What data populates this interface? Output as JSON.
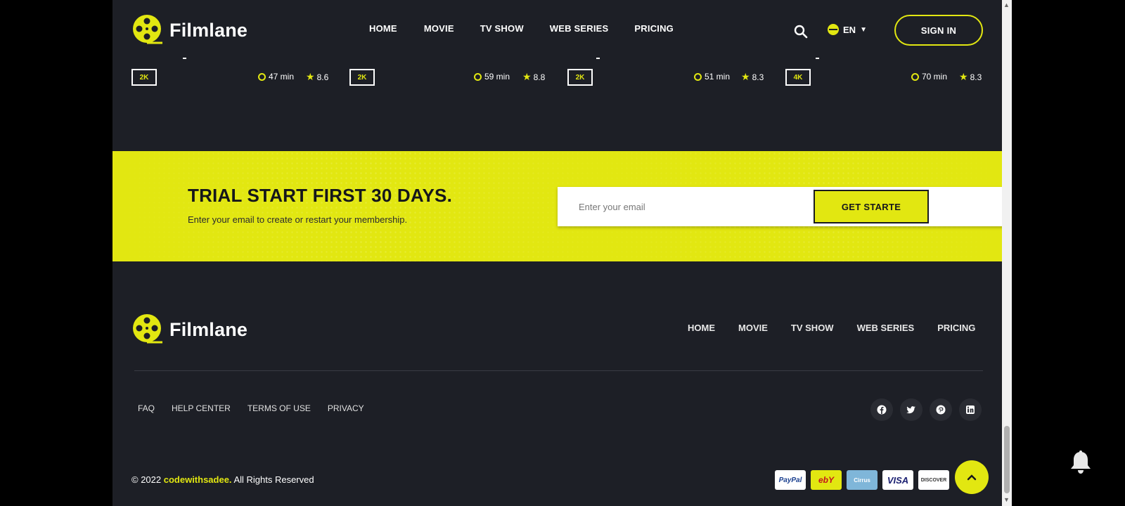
{
  "brand": {
    "name": "Filmlane"
  },
  "header": {
    "nav": [
      "HOME",
      "MOVIE",
      "TV SHOW",
      "WEB SERIES",
      "PRICING"
    ],
    "language": "EN",
    "signin_label": "SIGN IN"
  },
  "cards": [
    {
      "quality": "2K",
      "duration": "47 min",
      "rating": "8.6"
    },
    {
      "quality": "2K",
      "duration": "59 min",
      "rating": "8.8"
    },
    {
      "quality": "2K",
      "duration": "51 min",
      "rating": "8.3"
    },
    {
      "quality": "4K",
      "duration": "70 min",
      "rating": "8.3"
    }
  ],
  "cta": {
    "title": "TRIAL START FIRST 30 DAYS.",
    "subtitle": "Enter your email to create or restart your membership.",
    "email_placeholder": "Enter your email",
    "button_label": "GET STARTE"
  },
  "footer": {
    "nav": [
      "HOME",
      "MOVIE",
      "TV SHOW",
      "WEB SERIES",
      "PRICING"
    ],
    "links": [
      "FAQ",
      "HELP CENTER",
      "TERMS OF USE",
      "PRIVACY"
    ],
    "social_icons": [
      "facebook-icon",
      "twitter-icon",
      "pinterest-icon",
      "linkedin-icon"
    ],
    "copyright_prefix": "© 2022 ",
    "copyright_brand": "codewithsadee.",
    "copyright_suffix": " All Rights Reserved",
    "payments": [
      "PayPal",
      "ebY",
      "Cirrus",
      "VISA",
      "DISCOVER"
    ]
  },
  "colors": {
    "accent": "#e2e711",
    "background": "#1d1f26",
    "outer": "#000000"
  }
}
